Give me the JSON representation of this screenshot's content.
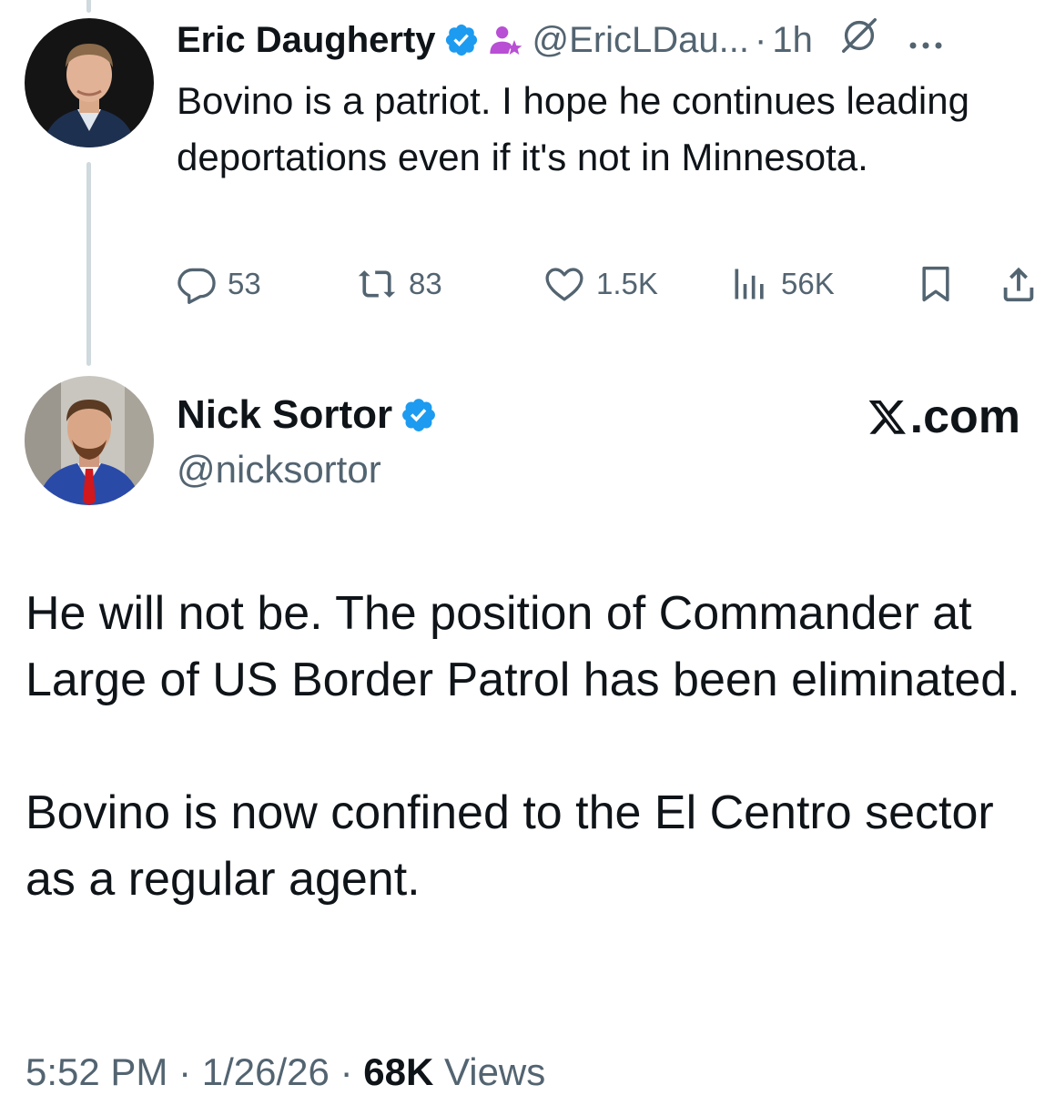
{
  "parent_tweet": {
    "display_name": "Eric Daugherty",
    "handle": "@EricLDau...",
    "separator": "·",
    "time": "1h",
    "text": "Bovino is a patriot. I hope he continues leading deportations even if it's not in Minnesota.",
    "icons": [
      "verified-badge-icon",
      "affiliate-person-icon",
      "grok-icon",
      "more-icon"
    ],
    "actions": {
      "replies": "53",
      "reposts": "83",
      "likes": "1.5K",
      "views": "56K"
    }
  },
  "main_tweet": {
    "display_name": "Nick Sortor",
    "handle": "@nicksortor",
    "watermark": ".com",
    "paragraphs": [
      "He will not be. The position of Commander at Large of US Border Patrol has been eliminated.",
      "Bovino is now confined to the El Centro sector as a regular agent."
    ],
    "meta": {
      "time": "5:52 PM",
      "date": "1/26/26",
      "separator": "·",
      "views_count": "68K",
      "views_label": "Views"
    }
  },
  "colors": {
    "verified_blue": "#1d9bf0",
    "affiliate_purple": "#b84fd4",
    "secondary_text": "#536471",
    "primary_text": "#0f1419",
    "thread_line": "#cfd9de"
  }
}
